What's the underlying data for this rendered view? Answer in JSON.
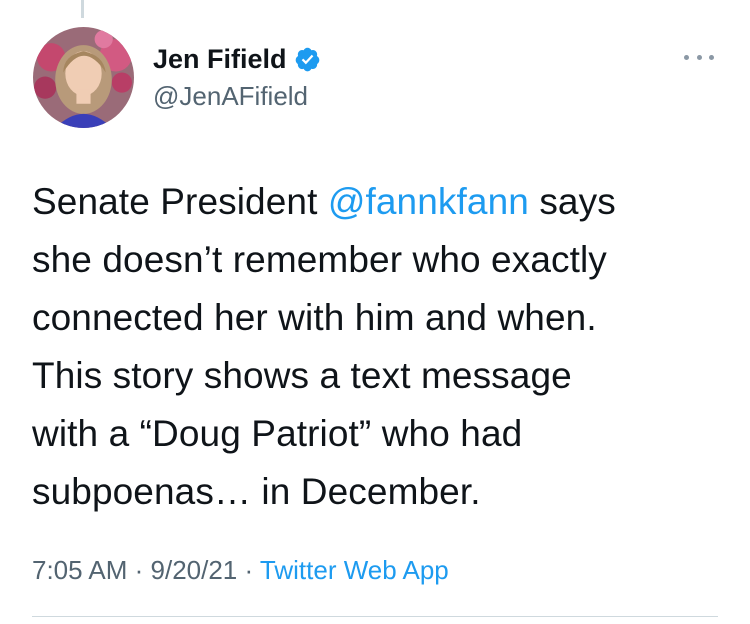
{
  "author": {
    "display_name": "Jen Fifield",
    "handle": "@JenAFifield",
    "verified": true,
    "avatar_icon": "profile-photo"
  },
  "tweet": {
    "lines": [
      {
        "pre": "Senate President ",
        "mention": "@fannkfann",
        "post": " says"
      },
      {
        "text": "she doesn’t remember who exactly"
      },
      {
        "text": "connected her with him and when."
      },
      {
        "text": "This story shows a text message"
      },
      {
        "text": "with a “Doug Patriot” who had"
      },
      {
        "text": "subpoenas… in December."
      }
    ]
  },
  "meta": {
    "time": "7:05 AM",
    "separator": " · ",
    "date": "9/20/21",
    "source": "Twitter Web App"
  },
  "icons": {
    "more": "more-horizontal-icon",
    "verified": "verified-badge-icon"
  },
  "colors": {
    "link": "#1d9bf0",
    "secondary_text": "#536471",
    "primary_text": "#0f1419",
    "verified_badge": "#1d9bf0"
  }
}
